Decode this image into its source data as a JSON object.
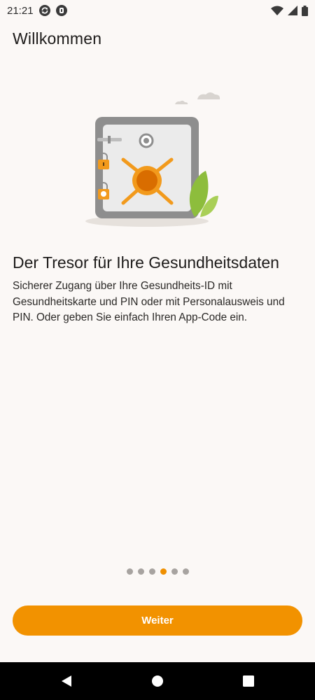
{
  "status_bar": {
    "time": "21:21",
    "left_icons": [
      "sync-icon",
      "app-notification-icon"
    ],
    "right_icons": [
      "wifi-icon",
      "signal-icon",
      "battery-icon"
    ]
  },
  "header": {
    "title": "Willkommen"
  },
  "illustration": {
    "icon": "safe-illustration",
    "colors": {
      "safe": "#8e8e8e",
      "accent": "#f29a1c",
      "leaf": "#8dbd3c"
    }
  },
  "content": {
    "headline": "Der Tresor für Ihre Gesundheitsdaten",
    "body": "Sicherer Zugang über Ihre Gesundheits-ID mit Gesundheitskarte und PIN oder mit Personalausweis und PIN. Oder geben Sie einfach Ihren App-Code ein."
  },
  "pager": {
    "total": 6,
    "active_index": 3,
    "active_color": "#ef8f00",
    "inactive_color": "#a7a3a0"
  },
  "button": {
    "label": "Weiter",
    "color": "#f29200"
  },
  "nav_bar": {
    "icons": [
      "back-icon",
      "home-icon",
      "recents-icon"
    ]
  }
}
